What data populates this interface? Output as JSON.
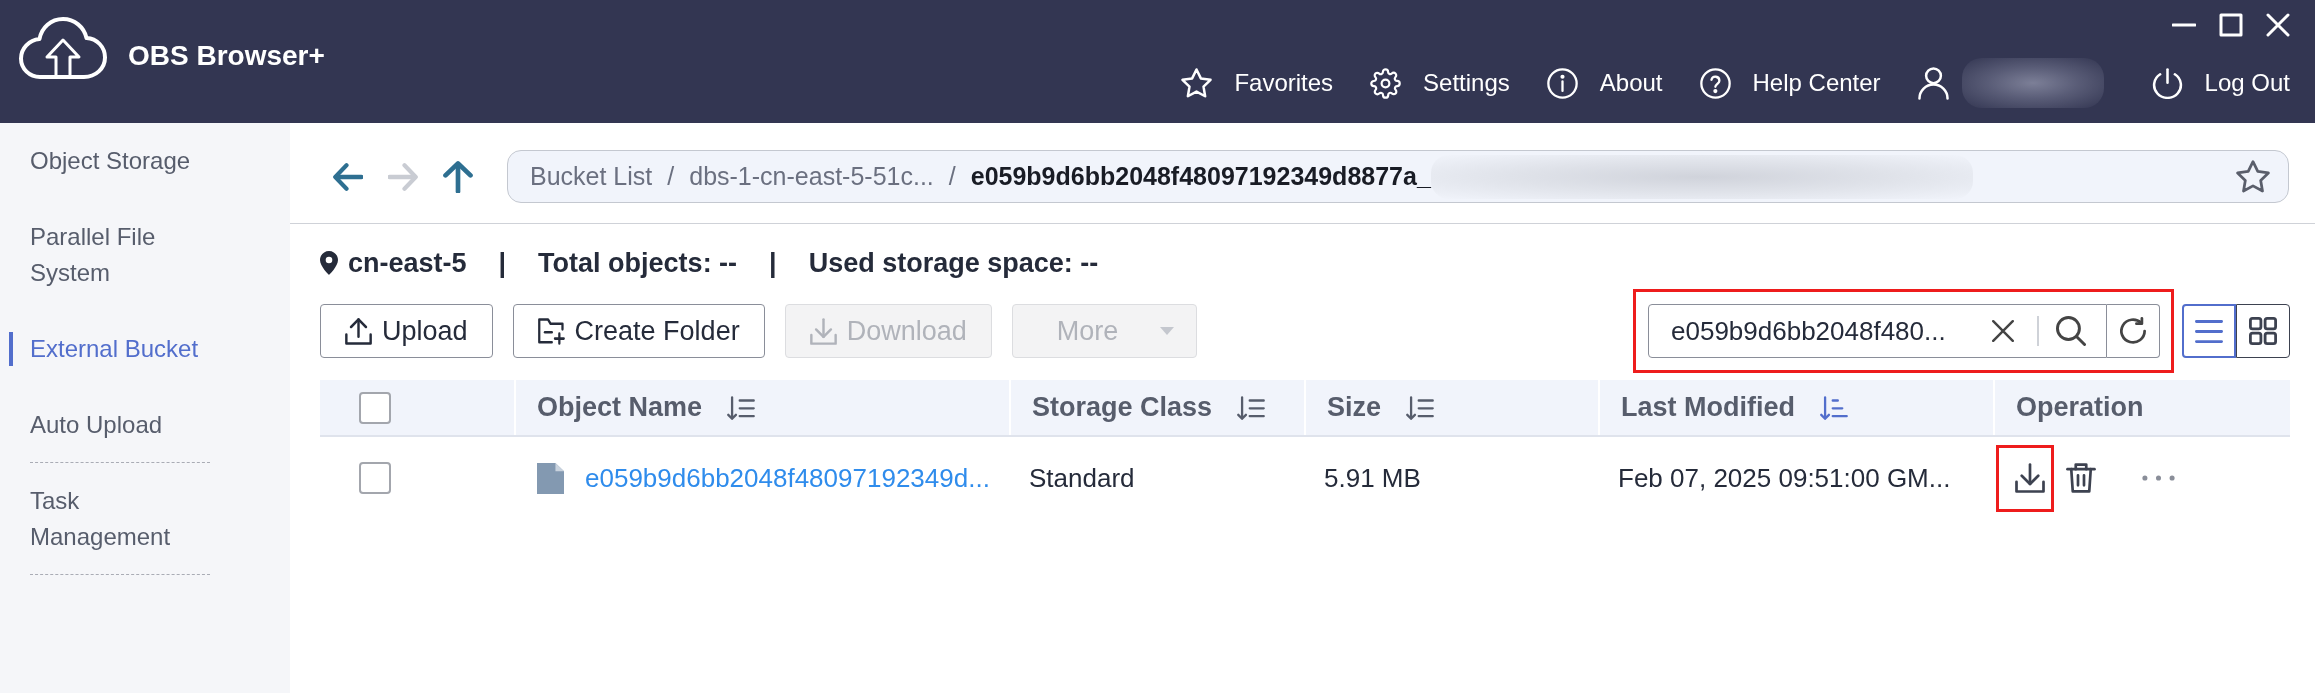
{
  "window_controls": [
    {
      "kind": "minimize"
    },
    {
      "kind": "maximize"
    },
    {
      "kind": "close"
    }
  ],
  "app": {
    "title": "OBS Browser+"
  },
  "header_nav": [
    {
      "kind": "favorites",
      "label": "Favorites"
    },
    {
      "kind": "settings",
      "label": "Settings"
    },
    {
      "kind": "about",
      "label": "About"
    },
    {
      "kind": "help",
      "label": "Help Center"
    },
    {
      "kind": "user",
      "redacted": true
    },
    {
      "kind": "logout",
      "label": "Log Out"
    }
  ],
  "sidebar": {
    "items": [
      {
        "label": "Object Storage",
        "selected": false,
        "separator": false
      },
      {
        "label": "Parallel File System",
        "selected": false,
        "separator": false
      },
      {
        "label": "External Bucket",
        "selected": true,
        "separator": false
      },
      {
        "label": "Auto Upload",
        "selected": false,
        "separator": true
      },
      {
        "label": "Task Management",
        "selected": false,
        "separator": true
      }
    ]
  },
  "location_bar": {
    "nav_buttons": [
      {
        "kind": "back",
        "disabled": false
      },
      {
        "kind": "forward",
        "disabled": true
      },
      {
        "kind": "up",
        "disabled": false
      }
    ],
    "path": [
      {
        "kind": "crumb",
        "text": "Bucket List"
      },
      {
        "kind": "separator",
        "text": "/"
      },
      {
        "kind": "crumb",
        "text": "dbs-1-cn-east-5-51c..."
      },
      {
        "kind": "separator",
        "text": "/"
      },
      {
        "kind": "current",
        "text": "e059b9d6bb2048f48097192349d8877a_"
      }
    ],
    "redacted_tail": true,
    "starred": false
  },
  "info_bar": [
    {
      "kind": "region",
      "text": "cn-east-5"
    },
    {
      "kind": "separator",
      "text": "|"
    },
    {
      "kind": "stat",
      "text": "Total objects: --"
    },
    {
      "kind": "separator",
      "text": "|"
    },
    {
      "kind": "stat",
      "text": "Used storage space: --"
    }
  ],
  "toolbar": {
    "buttons": [
      {
        "kind": "upload",
        "label": "Upload",
        "disabled": false
      },
      {
        "kind": "create_folder",
        "label": "Create Folder",
        "disabled": false
      },
      {
        "kind": "download",
        "label": "Download",
        "disabled": true
      },
      {
        "kind": "more",
        "label": "More",
        "disabled": true
      }
    ],
    "search": {
      "value": "e059b9d6bb2048f480...",
      "highlighted": true
    },
    "view_modes": [
      {
        "kind": "list",
        "selected": true
      },
      {
        "kind": "grid",
        "selected": false
      }
    ]
  },
  "table": {
    "select_all": {
      "checked": false
    },
    "columns": [
      {
        "label": "Object Name",
        "sortable": true,
        "sorted": false
      },
      {
        "label": "Storage Class",
        "sortable": true,
        "sorted": false
      },
      {
        "label": "Size",
        "sortable": true,
        "sorted": false
      },
      {
        "label": "Last Modified",
        "sortable": true,
        "sorted": true
      },
      {
        "label": "Operation",
        "sortable": false
      }
    ],
    "rows": [
      {
        "checked": false,
        "name": "e059b9d6bb2048f48097192349d...",
        "storage_class": "Standard",
        "size": "5.91 MB",
        "last_modified": "Feb 07, 2025 09:51:00 GM...",
        "operations": [
          {
            "kind": "download",
            "highlighted": true
          },
          {
            "kind": "delete",
            "highlighted": false
          },
          {
            "kind": "more",
            "highlighted": false
          }
        ]
      }
    ]
  }
}
